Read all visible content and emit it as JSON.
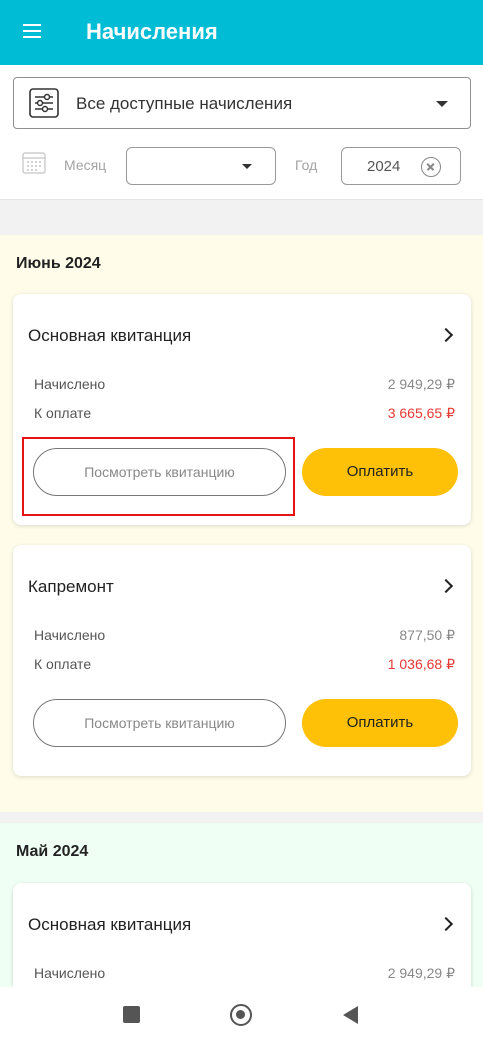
{
  "appbar": {
    "title": "Начисления",
    "menu_icon": "hamburger-menu-icon"
  },
  "filters": {
    "accruals_type": "Все доступные начисления",
    "month_label": "Месяц",
    "month_value": "",
    "year_label": "Год",
    "year_value": "2024"
  },
  "groups": [
    {
      "title": "Июнь 2024",
      "cards": [
        {
          "title": "Основная квитанция",
          "accrued_label": "Начислено",
          "accrued_value": "2 949,29 ₽",
          "due_label": "К оплате",
          "due_value": "3 665,65 ₽",
          "view_button": "Посмотреть квитанцию",
          "pay_button": "Оплатить"
        },
        {
          "title": "Капремонт",
          "accrued_label": "Начислено",
          "accrued_value": "877,50 ₽",
          "due_label": "К оплате",
          "due_value": "1 036,68 ₽",
          "view_button": "Посмотреть квитанцию",
          "pay_button": "Оплатить"
        }
      ]
    },
    {
      "title": "Май 2024",
      "cards": [
        {
          "title": "Основная квитанция",
          "accrued_label": "Начислено",
          "accrued_value": "2 949,29 ₽"
        }
      ]
    }
  ],
  "colors": {
    "accent": "#00bcd4",
    "pay_button": "#ffc107",
    "due_amount": "#e53935",
    "highlight": "#e41414"
  }
}
